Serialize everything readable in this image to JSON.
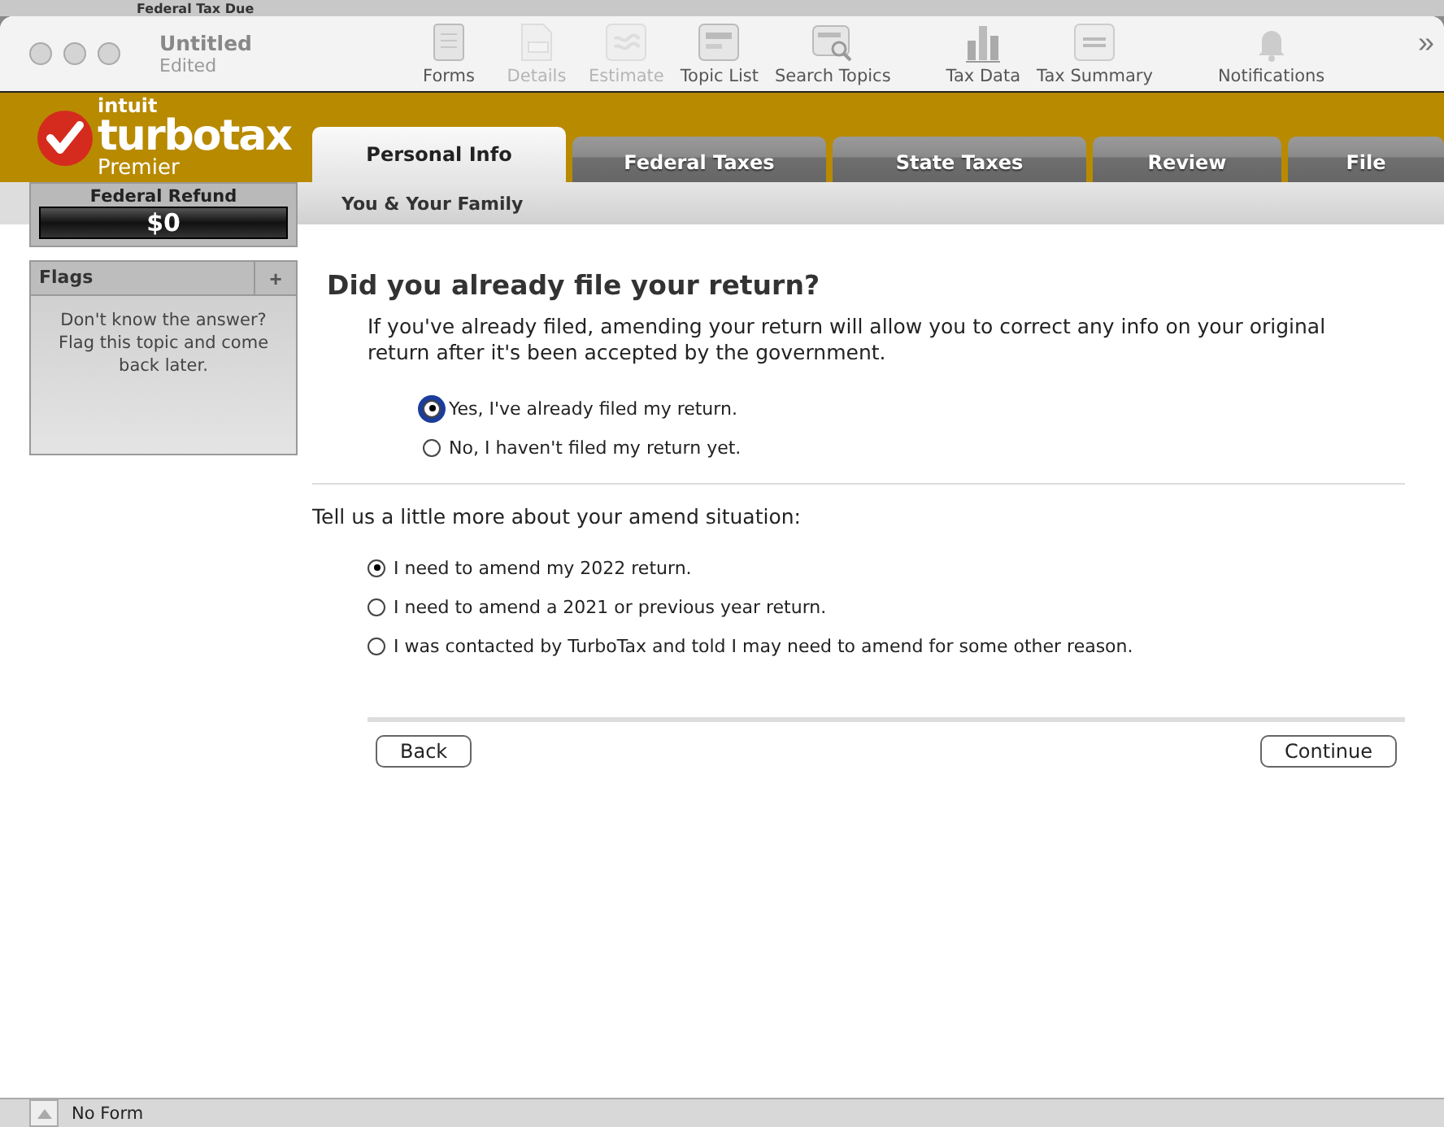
{
  "background_window": {
    "title": "Federal Tax Due"
  },
  "window": {
    "title": "Untitled",
    "subtitle": "Edited"
  },
  "toolbar": [
    {
      "label": "Forms",
      "disabled": false
    },
    {
      "label": "Details",
      "disabled": true
    },
    {
      "label": "Estimate",
      "disabled": true
    },
    {
      "label": "Topic List",
      "disabled": false
    },
    {
      "label": "Search Topics",
      "disabled": false
    },
    {
      "label": "Tax Data",
      "disabled": false
    },
    {
      "label": "Tax Summary",
      "disabled": false
    },
    {
      "label": "Notifications",
      "disabled": false
    }
  ],
  "toolbar_overflow": "»",
  "logo": {
    "brand": "intuit",
    "product": "turbotax",
    "edition": "Premier"
  },
  "tabs": [
    {
      "label": "Personal Info",
      "selected": true
    },
    {
      "label": "Federal Taxes",
      "selected": false
    },
    {
      "label": "State Taxes",
      "selected": false
    },
    {
      "label": "Review",
      "selected": false
    },
    {
      "label": "File",
      "selected": false
    }
  ],
  "refund": {
    "label": "Federal Refund",
    "amount": "$0"
  },
  "flags": {
    "title": "Flags",
    "add": "+",
    "message": "Don't know the answer? Flag this topic and come back later."
  },
  "breadcrumb": "You & Your Family",
  "question": {
    "title": "Did you already file your return?",
    "description": "If you've already filed, amending your return will allow you to correct any info on your original return after it's been accepted by the government."
  },
  "radio_groups": [
    {
      "options": [
        {
          "label": "Yes, I've already filed my return.",
          "selected": true,
          "focused": true
        },
        {
          "label": "No, I haven't filed my return yet.",
          "selected": false,
          "focused": false
        }
      ]
    },
    {
      "heading": "Tell us a little more about your amend situation:",
      "options": [
        {
          "label": "I need to amend my 2022 return.",
          "selected": true,
          "focused": false
        },
        {
          "label": "I need to amend a 2021 or previous year return.",
          "selected": false,
          "focused": false
        },
        {
          "label": "I was contacted by TurboTax and told I may need to amend for some other reason.",
          "selected": false,
          "focused": false
        }
      ]
    }
  ],
  "buttons": {
    "back": "Back",
    "continue": "Continue"
  },
  "status_bar": {
    "form": "No Form"
  }
}
